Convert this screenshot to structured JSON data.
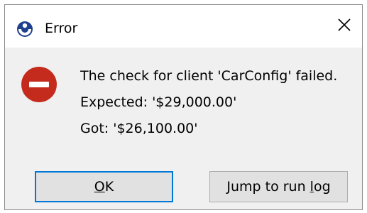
{
  "window": {
    "title": "Error",
    "app_icon": "app-logo-icon",
    "close_icon": "close-icon"
  },
  "message": {
    "icon": "error-icon",
    "line1": "The check for client 'CarConfig' failed.",
    "line2": "Expected: '$29,000.00'",
    "line3": "Got: '$26,100.00'"
  },
  "buttons": {
    "ok": {
      "accel": "O",
      "rest": "K"
    },
    "jump": {
      "before": "Jump to run ",
      "accel": "l",
      "after": "og"
    }
  },
  "colors": {
    "error_red": "#c42b1c",
    "focus_blue": "#0078d7",
    "logo_blue": "#1f3f8f"
  }
}
